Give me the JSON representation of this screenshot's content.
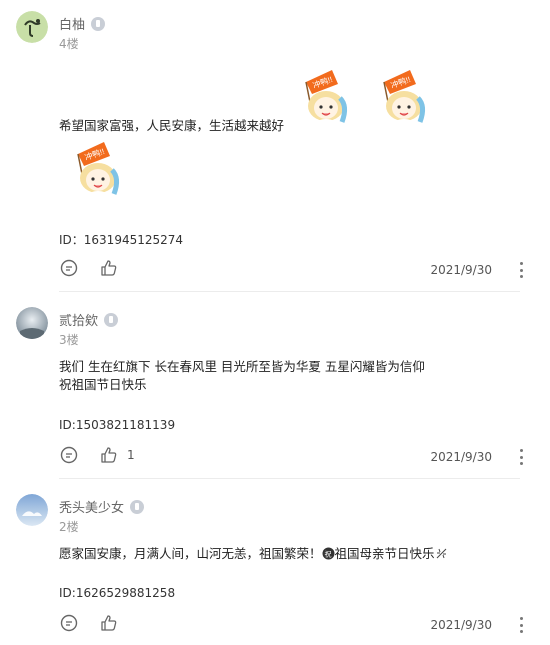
{
  "comments": [
    {
      "username": "白柚",
      "floor": "4楼",
      "text": "希望国家富强，人民安康，生活越来越好",
      "id": "ID：1631945125274",
      "likes": "",
      "date": "2021/9/30",
      "sticker_caption": "冲鸭!!"
    },
    {
      "username": "贰拾欸",
      "floor": "3楼",
      "text_line1": "我们 生在红旗下 长在春风里 目光所至皆为华夏 五星闪耀皆为信仰",
      "text_line2": "祝祖国节日快乐",
      "id": "ID:1503821181139",
      "likes": "1",
      "date": "2021/9/30"
    },
    {
      "username": "秃头美少女",
      "floor": "2楼",
      "text_before": "愿家国安康，月满人间，山河无恙，祖国繁荣！",
      "text_after": "祖国母亲节日快乐",
      "id": "ID:1626529881258",
      "likes": "",
      "date": "2021/9/30"
    }
  ],
  "icons": {
    "reply": "comment-bubble-icon",
    "like": "thumbs-up-icon",
    "more": "more-vertical-icon",
    "badge": "level-badge-icon"
  },
  "colors": {
    "text": "#222222",
    "muted": "#999999",
    "divider": "#ececec",
    "sticker_flag": "#f26b1d"
  }
}
